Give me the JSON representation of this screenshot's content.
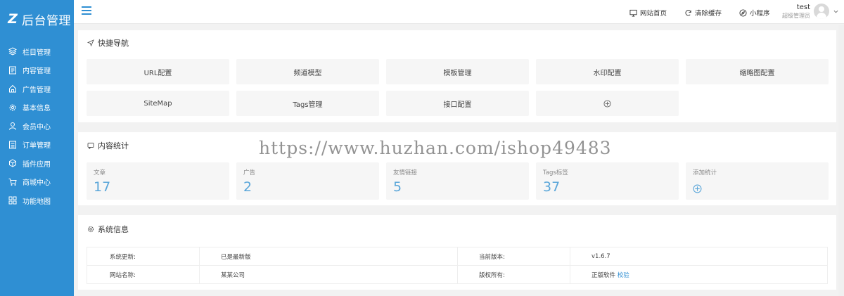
{
  "brand": {
    "logo_text": "后台管理",
    "logo_mark": "Z",
    "accent": "#2f8fd3"
  },
  "sidebar": {
    "items": [
      {
        "label": "栏目管理",
        "icon": "layers-icon"
      },
      {
        "label": "内容管理",
        "icon": "document-icon"
      },
      {
        "label": "广告管理",
        "icon": "home-icon"
      },
      {
        "label": "基本信息",
        "icon": "gear-icon"
      },
      {
        "label": "会员中心",
        "icon": "user-icon"
      },
      {
        "label": "订单管理",
        "icon": "list-icon"
      },
      {
        "label": "插件应用",
        "icon": "cube-icon"
      },
      {
        "label": "商城中心",
        "icon": "cart-icon"
      },
      {
        "label": "功能地图",
        "icon": "grid-icon"
      }
    ]
  },
  "topbar": {
    "site_home": "网站首页",
    "clear_cache": "清除缓存",
    "mini_program": "小程序",
    "user_name": "test",
    "user_role": "超级管理员"
  },
  "quick_nav": {
    "title": "快捷导航",
    "buttons": [
      "URL配置",
      "频道模型",
      "模板管理",
      "水印配置",
      "缩略图配置",
      "SiteMap",
      "Tags管理",
      "接口配置"
    ],
    "add_icon": "plus-circle-icon"
  },
  "stats": {
    "title": "内容统计",
    "items": [
      {
        "label": "文章",
        "value": "17"
      },
      {
        "label": "广告",
        "value": "2"
      },
      {
        "label": "友情链接",
        "value": "5"
      },
      {
        "label": "Tags标签",
        "value": "37"
      }
    ],
    "add_label": "添加统计"
  },
  "sysinfo": {
    "title": "系统信息",
    "rows": [
      {
        "k1": "系统更新:",
        "v1": "已是最新版",
        "k2": "当前版本:",
        "v2": "v1.6.7"
      },
      {
        "k1": "网站名称:",
        "v1": "某某公司",
        "k2": "版权所有:",
        "v2": "正版软件",
        "v2_link": "校验"
      }
    ]
  },
  "watermark": "https://www.huzhan.com/ishop49483"
}
